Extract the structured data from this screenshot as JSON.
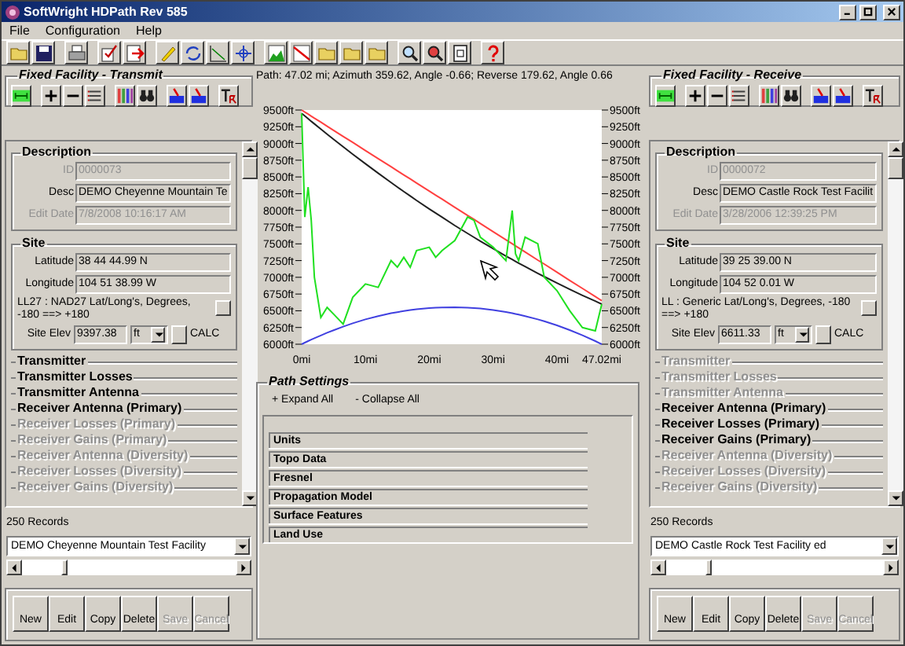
{
  "window": {
    "title": "SoftWright HDPath Rev 585"
  },
  "menu": [
    {
      "label": "File"
    },
    {
      "label": "Configuration"
    },
    {
      "label": "Help"
    }
  ],
  "transmit": {
    "title": "Fixed Facility - Transmit",
    "description": {
      "heading": "Description",
      "fields": [
        {
          "label": "ID",
          "value": "0000073",
          "disabled": true
        },
        {
          "label": "Desc",
          "value": "DEMO Cheyenne Mountain Te",
          "disabled": false
        },
        {
          "label": "Edit Date",
          "value": "7/8/2008 10:16:17 AM",
          "disabled": true
        }
      ]
    },
    "site": {
      "heading": "Site",
      "fields": [
        {
          "label": "Latitude",
          "value": "38 44 44.99 N",
          "disabled": false
        },
        {
          "label": "Longitude",
          "value": "104 51 38.99 W",
          "disabled": false
        }
      ],
      "datum": "LL27 : NAD27 Lat/Long's, Degrees, -180 ==> +180",
      "elev_label": "Site Elev",
      "elev": "9397.38",
      "unit": "ft",
      "calc": "CALC"
    },
    "sections": [
      {
        "label": "Transmitter",
        "disabled": false
      },
      {
        "label": "Transmitter Losses",
        "disabled": false
      },
      {
        "label": "Transmitter Antenna",
        "disabled": false
      },
      {
        "label": "Receiver Antenna (Primary)",
        "disabled": false
      },
      {
        "label": "Receiver Losses (Primary)",
        "disabled": true
      },
      {
        "label": "Receiver Gains (Primary)",
        "disabled": true
      },
      {
        "label": "Receiver Antenna (Diversity)",
        "disabled": true
      },
      {
        "label": "Receiver Losses (Diversity)",
        "disabled": true
      },
      {
        "label": "Receiver Gains (Diversity)",
        "disabled": true
      }
    ],
    "records": "250 Records",
    "facility": "DEMO Cheyenne Mountain Test Facility",
    "buttons": [
      {
        "label": "New",
        "disabled": false
      },
      {
        "label": "Edit",
        "disabled": false
      },
      {
        "label": "Copy",
        "disabled": false
      },
      {
        "label": "Delete",
        "disabled": false
      },
      {
        "label": "Save",
        "disabled": true
      },
      {
        "label": "Cancel",
        "disabled": true
      }
    ]
  },
  "path": {
    "info": "Path: 47.02 mi; Azimuth 359.62, Angle -0.66; Reverse 179.62, Angle 0.66",
    "chart_data": {
      "type": "line",
      "x": [
        0,
        0.5,
        1,
        1.5,
        2,
        3,
        4,
        5,
        6.5,
        8,
        10,
        12,
        14,
        15,
        16,
        17,
        18,
        20,
        21,
        22,
        24,
        26,
        27,
        28,
        30,
        32,
        33,
        33.5,
        34,
        35,
        37,
        38,
        40,
        42,
        44,
        46,
        47.02
      ],
      "series": [
        {
          "color": "#ff4040",
          "values": [
            9500,
            9470,
            9439,
            9409,
            9379,
            9318,
            9258,
            9197,
            9106,
            9015,
            8894,
            8773,
            8651,
            8591,
            8530,
            8470,
            8409,
            8288,
            8227,
            8167,
            8045,
            7924,
            7864,
            7803,
            7682,
            7560,
            7500,
            7470,
            7439,
            7379,
            7257,
            7197,
            7076,
            6954,
            6833,
            6712,
            6650
          ]
        },
        {
          "color": "#202020",
          "values": [
            9450,
            9411,
            9371,
            9332,
            9293,
            9215,
            9139,
            9063,
            8951,
            8840,
            8696,
            8555,
            8416,
            8349,
            8282,
            8216,
            8150,
            8022,
            7959,
            7897,
            7774,
            7655,
            7598,
            7540,
            7428,
            7318,
            7265,
            7239,
            7212,
            7161,
            7059,
            7010,
            6914,
            6820,
            6730,
            6643,
            6600
          ]
        },
        {
          "color": "#4040e0",
          "values": [
            6000,
            6023,
            6046,
            6068,
            6090,
            6132,
            6172,
            6210,
            6263,
            6312,
            6370,
            6420,
            6462,
            6480,
            6496,
            6510,
            6522,
            6540,
            6546,
            6550,
            6552,
            6547,
            6541,
            6533,
            6511,
            6481,
            6463,
            6453,
            6443,
            6421,
            6371,
            6343,
            6281,
            6211,
            6133,
            6047,
            6000
          ]
        },
        {
          "color": "#20e020",
          "values": [
            9450,
            7900,
            8350,
            7850,
            7000,
            6400,
            6550,
            6450,
            6300,
            6700,
            6900,
            6850,
            7250,
            7150,
            7300,
            7150,
            7400,
            7450,
            7300,
            7400,
            7550,
            7900,
            7850,
            7600,
            7450,
            7250,
            8000,
            7350,
            7250,
            7600,
            7500,
            7000,
            6800,
            6500,
            6250,
            6200,
            6600
          ]
        }
      ],
      "xlim": [
        0,
        47.02
      ],
      "ylim": [
        6000,
        9500
      ],
      "xticks": [
        {
          "value": 0,
          "label": "0mi"
        },
        {
          "value": 10,
          "label": "10mi"
        },
        {
          "value": 20,
          "label": "20mi"
        },
        {
          "value": 30,
          "label": "30mi"
        },
        {
          "value": 40,
          "label": "40mi"
        },
        {
          "value": 47.02,
          "label": "47.02mi"
        }
      ],
      "yticks": [
        {
          "value": 6000,
          "label": "6000ft"
        },
        {
          "value": 6250,
          "label": "6250ft"
        },
        {
          "value": 6500,
          "label": "6500ft"
        },
        {
          "value": 6750,
          "label": "6750ft"
        },
        {
          "value": 7000,
          "label": "7000ft"
        },
        {
          "value": 7250,
          "label": "7250ft"
        },
        {
          "value": 7500,
          "label": "7500ft"
        },
        {
          "value": 7750,
          "label": "7750ft"
        },
        {
          "value": 8000,
          "label": "8000ft"
        },
        {
          "value": 8250,
          "label": "8250ft"
        },
        {
          "value": 8500,
          "label": "8500ft"
        },
        {
          "value": 8750,
          "label": "8750ft"
        },
        {
          "value": 9000,
          "label": "9000ft"
        },
        {
          "value": 9250,
          "label": "9250ft"
        },
        {
          "value": 9500,
          "label": "9500ft"
        }
      ]
    },
    "settings": {
      "title": "Path Settings",
      "expand": "+ Expand All",
      "collapse": "- Collapse All",
      "items": [
        {
          "label": "Units"
        },
        {
          "label": "Topo Data"
        },
        {
          "label": "Fresnel"
        },
        {
          "label": "Propagation Model"
        },
        {
          "label": "Surface Features"
        },
        {
          "label": "Land Use"
        }
      ]
    }
  },
  "receive": {
    "title": "Fixed Facility - Receive",
    "description": {
      "heading": "Description",
      "fields": [
        {
          "label": "ID",
          "value": "0000072",
          "disabled": true
        },
        {
          "label": "Desc",
          "value": "DEMO Castle Rock Test Facilit",
          "disabled": false
        },
        {
          "label": "Edit Date",
          "value": "3/28/2006 12:39:25 PM",
          "disabled": true
        }
      ]
    },
    "site": {
      "heading": "Site",
      "fields": [
        {
          "label": "Latitude",
          "value": "39 25 39.00 N",
          "disabled": false
        },
        {
          "label": "Longitude",
          "value": "104 52 0.01 W",
          "disabled": false
        }
      ],
      "datum": "LL : Generic Lat/Long's, Degrees, -180 ==> +180",
      "elev_label": "Site Elev",
      "elev": "6611.33",
      "unit": "ft",
      "calc": "CALC"
    },
    "sections": [
      {
        "label": "Transmitter",
        "disabled": true
      },
      {
        "label": "Transmitter Losses",
        "disabled": true
      },
      {
        "label": "Transmitter Antenna",
        "disabled": true
      },
      {
        "label": "Receiver Antenna (Primary)",
        "disabled": false
      },
      {
        "label": "Receiver Losses (Primary)",
        "disabled": false
      },
      {
        "label": "Receiver Gains (Primary)",
        "disabled": false
      },
      {
        "label": "Receiver Antenna (Diversity)",
        "disabled": true
      },
      {
        "label": "Receiver Losses (Diversity)",
        "disabled": true
      },
      {
        "label": "Receiver Gains (Diversity)",
        "disabled": true
      }
    ],
    "records": "250 Records",
    "facility": "DEMO Castle Rock Test Facility ed",
    "buttons": [
      {
        "label": "New",
        "disabled": false
      },
      {
        "label": "Edit",
        "disabled": false
      },
      {
        "label": "Copy",
        "disabled": false
      },
      {
        "label": "Delete",
        "disabled": false
      },
      {
        "label": "Save",
        "disabled": true
      },
      {
        "label": "Cancel",
        "disabled": true
      }
    ]
  }
}
